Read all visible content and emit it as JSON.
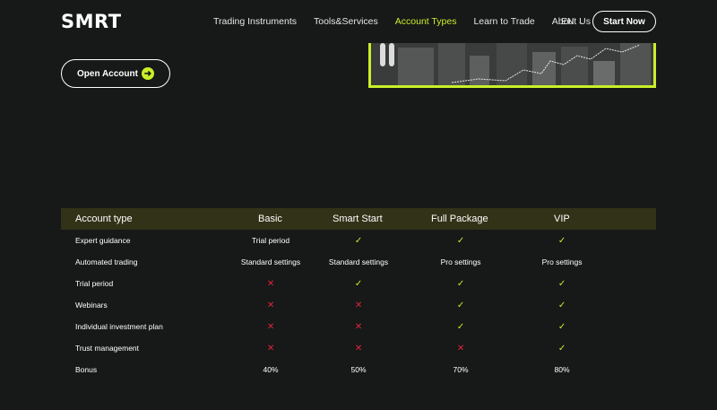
{
  "header": {
    "logo_text": "SMRT",
    "nav": [
      "Trading Instruments",
      "Tools&Services",
      "Account Types",
      "Learn to Trade",
      "About Us"
    ],
    "active_nav": "Account Types",
    "language": "EN",
    "start_label": "Start Now"
  },
  "hero": {
    "open_account_label": "Open Account"
  },
  "colors": {
    "accent": "#c9ee2a",
    "background": "#171818",
    "header_row": "#323218",
    "cross": "#e0263b"
  },
  "table": {
    "columns": [
      "Account type",
      "Basic",
      "Smart Start",
      "Full Package",
      "VIP"
    ],
    "rows": [
      {
        "label": "Expert guidance",
        "cells": [
          {
            "t": "text",
            "v": "Trial period"
          },
          {
            "t": "check",
            "v": "✓"
          },
          {
            "t": "check",
            "v": "✓"
          },
          {
            "t": "check",
            "v": "✓"
          }
        ]
      },
      {
        "label": "Automated trading",
        "cells": [
          {
            "t": "text",
            "v": "Standard settings"
          },
          {
            "t": "text",
            "v": "Standard settings"
          },
          {
            "t": "text",
            "v": "Pro settings"
          },
          {
            "t": "text",
            "v": "Pro settings"
          }
        ]
      },
      {
        "label": "Trial period",
        "cells": [
          {
            "t": "cross",
            "v": "✕"
          },
          {
            "t": "check",
            "v": "✓"
          },
          {
            "t": "check",
            "v": "✓"
          },
          {
            "t": "check",
            "v": "✓"
          }
        ]
      },
      {
        "label": "Webinars",
        "cells": [
          {
            "t": "cross",
            "v": "✕"
          },
          {
            "t": "cross",
            "v": "✕"
          },
          {
            "t": "check",
            "v": "✓"
          },
          {
            "t": "check",
            "v": "✓"
          }
        ]
      },
      {
        "label": "Individual investment plan",
        "cells": [
          {
            "t": "cross",
            "v": "✕"
          },
          {
            "t": "cross",
            "v": "✕"
          },
          {
            "t": "check",
            "v": "✓"
          },
          {
            "t": "check",
            "v": "✓"
          }
        ]
      },
      {
        "label": "Trust management",
        "cells": [
          {
            "t": "cross",
            "v": "✕"
          },
          {
            "t": "cross",
            "v": "✕"
          },
          {
            "t": "cross",
            "v": "✕"
          },
          {
            "t": "check",
            "v": "✓"
          }
        ]
      },
      {
        "label": "Bonus",
        "cells": [
          {
            "t": "text",
            "v": "40%"
          },
          {
            "t": "text",
            "v": "50%"
          },
          {
            "t": "text",
            "v": "70%"
          },
          {
            "t": "text",
            "v": "80%"
          }
        ]
      }
    ]
  }
}
